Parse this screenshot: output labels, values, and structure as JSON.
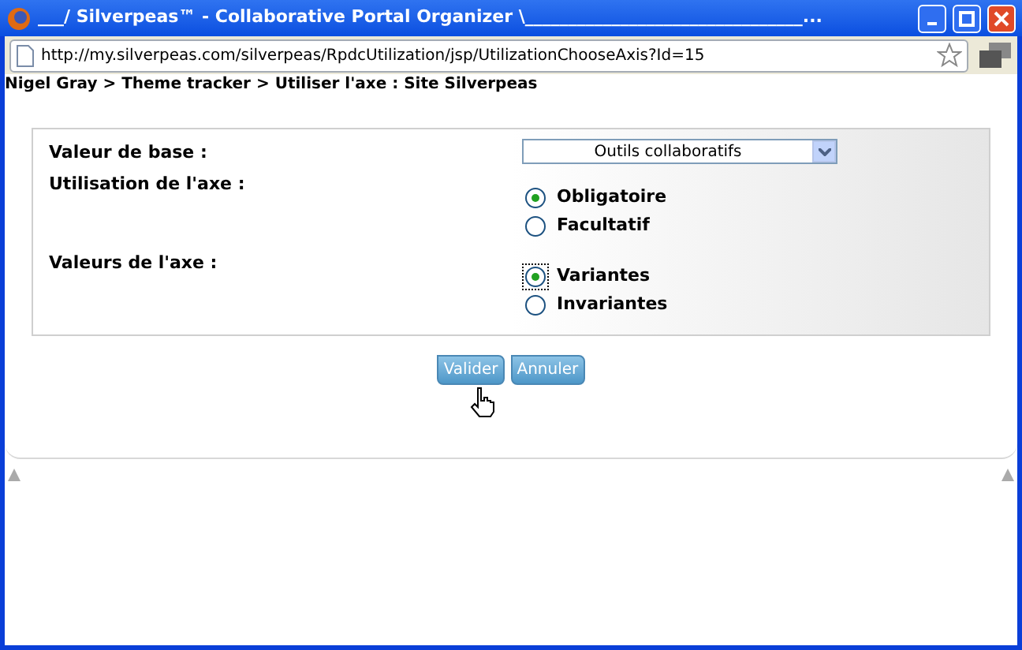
{
  "window": {
    "title": "___/ Silverpeas™ - Collaborative Portal Organizer \\________________________________..."
  },
  "address_bar": {
    "url": "http://my.silverpeas.com/silverpeas/RpdcUtilization/jsp/UtilizationChooseAxis?Id=15"
  },
  "breadcrumb": "Nigel Gray > Theme tracker > Utiliser l'axe : Site Silverpeas",
  "form": {
    "rows": [
      {
        "kind": "select",
        "label": "Valeur de base :",
        "value": "Outils collaboratifs"
      },
      {
        "kind": "radio",
        "label": "Utilisation de l'axe :",
        "options": [
          {
            "label": "Obligatoire",
            "selected": true,
            "focused": false
          },
          {
            "label": "Facultatif",
            "selected": false,
            "focused": false
          }
        ]
      },
      {
        "kind": "radio",
        "label": "Valeurs de l'axe :",
        "options": [
          {
            "label": "Variantes",
            "selected": true,
            "focused": true
          },
          {
            "label": "Invariantes",
            "selected": false,
            "focused": false
          }
        ]
      }
    ]
  },
  "buttons": [
    {
      "label": "Valider"
    },
    {
      "label": "Annuler"
    }
  ]
}
